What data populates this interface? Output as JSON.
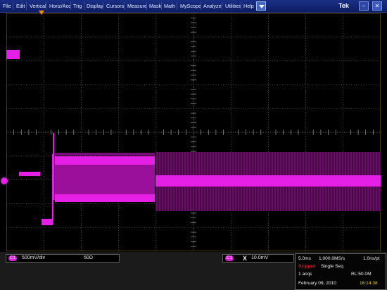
{
  "menu": {
    "items": [
      "File",
      "Edit",
      "Vertical",
      "Horiz/Acq",
      "Trig",
      "Display",
      "Cursors",
      "Measure",
      "Mask",
      "Math",
      "MyScope",
      "Analyze",
      "Utilities",
      "Help"
    ],
    "brand": "Tek"
  },
  "window_buttons": [
    "−",
    "✕"
  ],
  "channel1": {
    "badge": "C1",
    "scale": "500mV/div",
    "termination": "50Ω"
  },
  "trigger": {
    "badge": "C1",
    "symbol": "X",
    "level": "10.0mV"
  },
  "acquisition": {
    "timebase": "5.0ms",
    "sample_rate": "1,000.0MS/s",
    "resolution": "1.0ns/pt",
    "state": "Stopped",
    "mode": "Single Seq",
    "acqs": "1 acqs",
    "record_length": "RL:50.0M",
    "date": "February 09, 2010",
    "time": "16:14:38"
  },
  "colors": {
    "trace": "#e61fe6",
    "grid": "#8c8c8c",
    "menubar": "#13246e",
    "trigger_marker": "#ff8c00"
  }
}
